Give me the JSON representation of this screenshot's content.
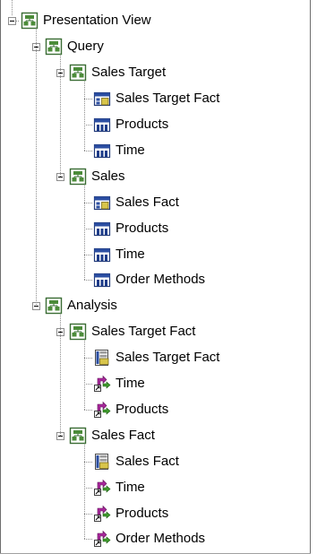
{
  "tree": [
    {
      "label": "Presentation View",
      "icon": "catalog-folder-icon",
      "children": [
        {
          "label": "Query",
          "icon": "catalog-folder-icon",
          "children": [
            {
              "label": "Sales Target",
              "icon": "catalog-folder-icon",
              "children": [
                {
                  "label": "Sales Target Fact",
                  "icon": "fact-table-icon"
                },
                {
                  "label": "Products",
                  "icon": "dimension-table-icon"
                },
                {
                  "label": "Time",
                  "icon": "dimension-table-icon"
                }
              ]
            },
            {
              "label": "Sales",
              "icon": "catalog-folder-icon",
              "children": [
                {
                  "label": "Sales Fact",
                  "icon": "fact-table-icon"
                },
                {
                  "label": "Products",
                  "icon": "dimension-table-icon"
                },
                {
                  "label": "Time",
                  "icon": "dimension-table-icon"
                },
                {
                  "label": "Order Methods",
                  "icon": "dimension-table-icon"
                }
              ]
            }
          ]
        },
        {
          "label": "Analysis",
          "icon": "catalog-folder-icon",
          "children": [
            {
              "label": "Sales Target Fact",
              "icon": "catalog-folder-icon",
              "children": [
                {
                  "label": "Sales Target Fact",
                  "icon": "measure-dimension-icon"
                },
                {
                  "label": "Time",
                  "icon": "shortcut-icon"
                },
                {
                  "label": "Products",
                  "icon": "shortcut-icon"
                }
              ]
            },
            {
              "label": "Sales Fact",
              "icon": "catalog-folder-icon",
              "children": [
                {
                  "label": "Sales Fact",
                  "icon": "measure-dimension-icon"
                },
                {
                  "label": "Time",
                  "icon": "shortcut-icon"
                },
                {
                  "label": "Products",
                  "icon": "shortcut-icon"
                },
                {
                  "label": "Order Methods",
                  "icon": "shortcut-icon"
                }
              ]
            }
          ]
        }
      ]
    }
  ]
}
